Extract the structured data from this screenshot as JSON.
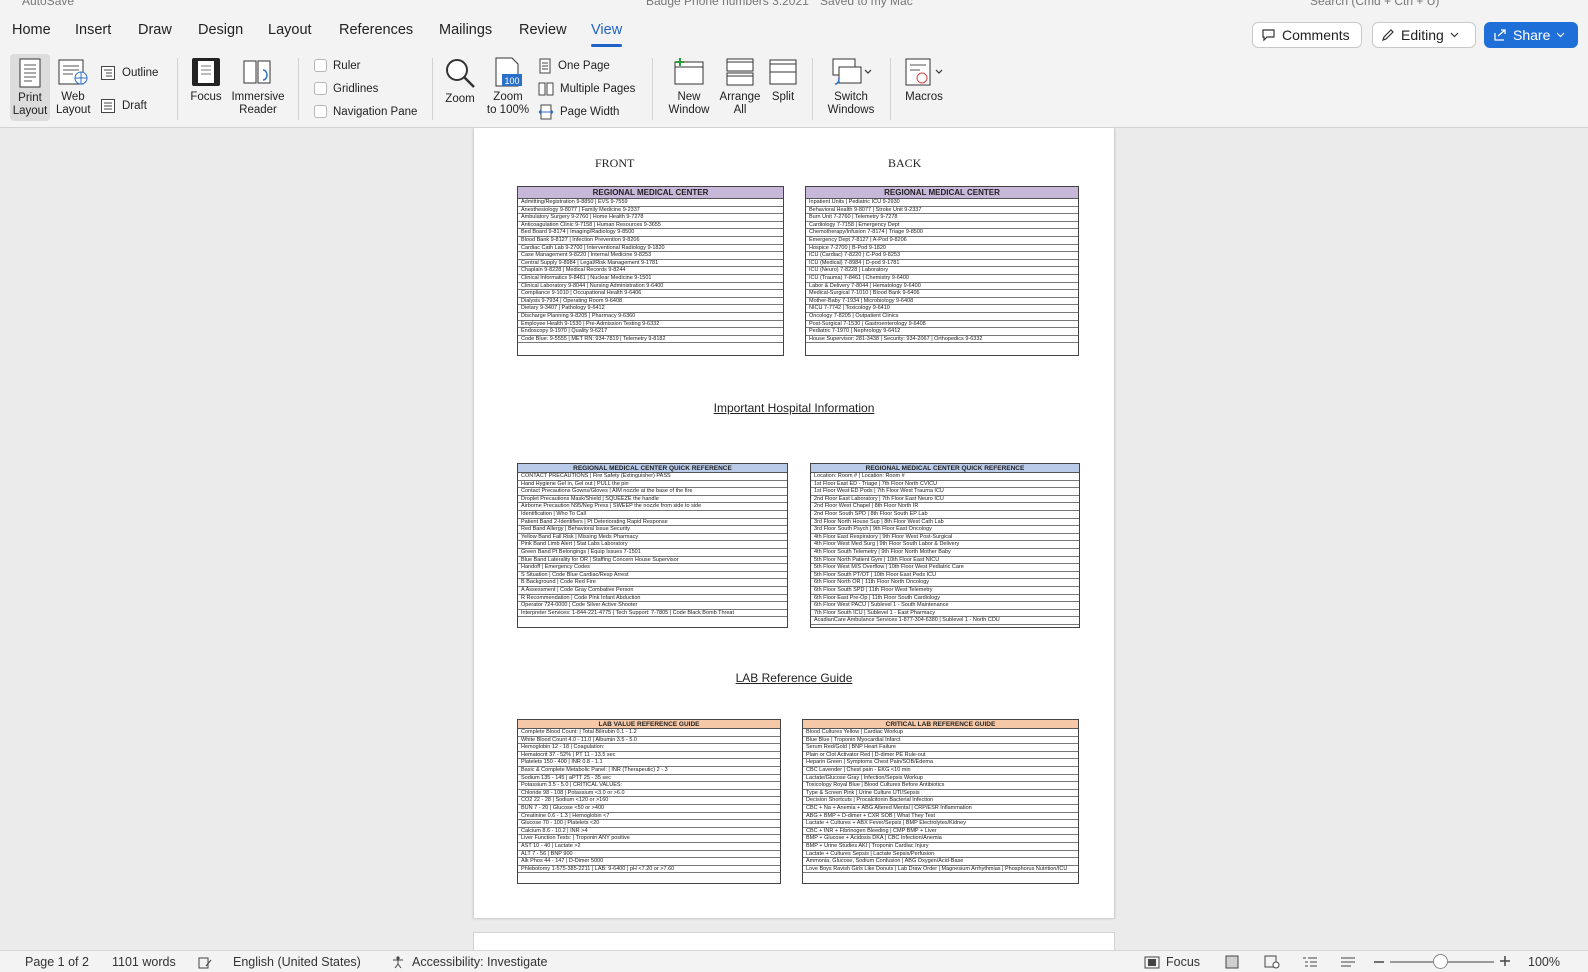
{
  "window": {
    "autosave_label": "AutoSave",
    "doc_title": "Badge Phone numbers 3.2021",
    "save_status": "Saved to my Mac",
    "search_placeholder": "Search (Cmd + Ctrl + U)"
  },
  "tabs": [
    "Home",
    "Insert",
    "Draw",
    "Design",
    "Layout",
    "References",
    "Mailings",
    "Review",
    "View"
  ],
  "active_tab": "View",
  "header_buttons": {
    "comments": "Comments",
    "editing": "Editing",
    "share": "Share"
  },
  "ribbon": {
    "print_layout": [
      "Print",
      "Layout"
    ],
    "web_layout": [
      "Web",
      "Layout"
    ],
    "outline": "Outline",
    "draft": "Draft",
    "focus": "Focus",
    "immersive_reader": [
      "Immersive",
      "Reader"
    ],
    "ruler": "Ruler",
    "gridlines": "Gridlines",
    "navigation_pane": "Navigation Pane",
    "zoom": "Zoom",
    "zoom_100": [
      "Zoom",
      "to 100%"
    ],
    "one_page": "One Page",
    "multiple_pages": "Multiple Pages",
    "page_width": "Page Width",
    "new_window": [
      "New",
      "Window"
    ],
    "arrange_all": [
      "Arrange",
      "All"
    ],
    "split": "Split",
    "switch_windows": [
      "Switch",
      "Windows"
    ],
    "macros": "Macros"
  },
  "document": {
    "front_label": "FRONT",
    "back_label": "BACK",
    "section1_title": "Important Hospital Information",
    "section2_title": "LAB Reference Guide",
    "cards": {
      "front": {
        "title": "REGIONAL MEDICAL CENTER",
        "rows": [
          "Admitting/Registration 9-8850 | EVS 9-7559",
          "Anesthesiology 9-8077 | Family Medicine 9-2337",
          "Ambulatory Surgery 9-2760 | Home Health 9-7278",
          "Anticoagulation Clinic 9-7158 | Human Resources 9-3655",
          "Bed Board 9-8174 | Imaging/Radiology 9-8500",
          "Blood Bank 9-8127 | Infection Prevention 9-8206",
          "Cardiac Cath Lab 9-2700 | Interventional Radiology 9-1820",
          "Case Management 9-8220 | Internal Medicine 9-8253",
          "Central Supply 9-8984 | Legal/Risk Management 9-1781",
          "Chaplain 9-8228 | Medical Records 9-8244",
          "Clinical Informatics 9-8461 | Nuclear Medicine 9-1501",
          "Clinical Laboratory 9-8044 | Nursing Administration 9-6400",
          "Compliance 9-1010 | Occupational Health 9-6406",
          "Dialysis 9-7934 | Operating Room 9-6408",
          "Dietary 9-3407 | Pathology 9-6412",
          "Discharge Planning 9-8205 | Pharmacy 9-6360",
          "Employee Health 9-1530 | Pre-Admission Testing 9-6332",
          "Endoscopy 9-1970 | Quality 9-6217",
          "Code Blue: 9-5555 | MET RN: 934-7819 | Telemetry 9-8182"
        ]
      },
      "back": {
        "title": "REGIONAL MEDICAL CENTER",
        "rows": [
          "Inpatient Units | Pediatric ICU 9-2930",
          "Behavioral Health 9-8077 | Stroke Unit 9-2337",
          "Burn Unit 7-2760 | Telemetry 9-7278",
          "Cardiology 7-7158 | Emergency Dept",
          "Chemotherapy/Infusion 7-8174 | Triage 9-8500",
          "Emergency Dept 7-8127 | A-Pod 9-8206",
          "Hospice 7-2700 | B-Pod 9-1820",
          "ICU (Cardiac) 7-8220 | C-Pod 9-8253",
          "ICU (Medical) 7-8984 | D-pod 9-1781",
          "ICU (Neuro) 7-8228 | Laboratory",
          "ICU (Trauma) 7-8461 | Chemistry 9-6400",
          "Labor & Delivery 7-8044 | Hematology 9-6400",
          "Medical-Surgical 7-1010 | Blood Bank 9-6406",
          "Mother-Baby 7-1934 | Microbiology 9-6408",
          "NICU 7-7742 | Toxicology 9-6410",
          "Oncology 7-8205 | Outpatient Clinics",
          "Post-Surgical 7-1530 | Gastroenterology 9-6408",
          "Pediatric 7-1970 | Nephrology 9-6412",
          "House Supervisor: 281-3438 | Security: 934-2067 | Orthopedics 9-6332"
        ]
      },
      "quick_ref": {
        "title": "REGIONAL MEDICAL CENTER QUICK REFERENCE",
        "rows": [
          "CONTACT PRECAUTIONS | Fire Safety (Extinguisher) PASS",
          "Hand Hygiene Gel in, Gel out | PULL the pin",
          "Contact Precautions Gowns/Gloves | AIM nozzle at the base of the fire",
          "Droplet Precautions Mask/Shield | SQUEEZE the handle",
          "Airborne Precaution N95/Neg Press | SWEEP the nozzle from side to side",
          "Identification | Who To Call",
          "Patient Band 2-Identifiers | Pt Deteriorating Rapid Response",
          "Red Band Allergy | Behavioral Issue Security",
          "Yellow Band Fall Risk | Missing Meds Pharmacy",
          "Pink Band Limb Alert | Stat Labs Laboratory",
          "Green Band Pt Belongings | Equip Issues 7-1501",
          "Blue Band Laterality for OR | Staffing Concern House Supervisor",
          "Handoff | Emergency Codes",
          "S Situation | Code Blue Cardiac/Resp Arrest",
          "B Background | Code Red Fire",
          "A Assessment | Code Gray Combative Person",
          "R Recommendation | Code Pink Infant Abduction",
          "Operator 724-0000 | Code Silver Active Shooter",
          "Interpreter Services: 1-844-221-4775 | Tech Support: 7-7805 | Code Black Bomb Threat"
        ]
      },
      "room_ref": {
        "title": "REGIONAL MEDICAL CENTER QUICK REFERENCE",
        "rows": [
          "Location: Room # | Location: Room #",
          "1st Floor East ED - Triage | 7th Floor North CVICU",
          "1st Floor West ED Pods | 7th Floor West Trauma ICU",
          "2nd Floor East Laboratory | 7th Floor East Neuro ICU",
          "2nd Floor West Chapel | 8th Floor North IR",
          "2nd Floor South SPD | 8th Floor South EP Lab",
          "3rd Floor North House Sup | 8th Floor West Cath Lab",
          "3rd Floor South Psych | 9th Floor East Oncology",
          "4th Floor East Respiratory | 9th Floor West Post-Surgical",
          "4th Floor West Med Surg | 9th Floor South Labor & Delivery",
          "4th Floor South Telemetry | 9th Floor North Mother Baby",
          "5th Floor North Patient Gym | 10th Floor East NICU",
          "5th Floor West M/S Overflow | 10th Floor West Pediatric Care",
          "5th Floor South PT/OT | 10th Floor East Peds ICU",
          "6th Floor North OR | 11th Floor North Oncology",
          "6th Floor South SPD | 11th Floor West Telemetry",
          "6th Floor East Pre-Op | 11th Floor South Cardiology",
          "6th Floor West PACU | Sublevel 1 - South Maintenance",
          "7th Floor South ICU | Sublevel 1 - East Pharmacy",
          "AcadianCare Ambulance Services 1-877-304-6380 | Sublevel 1 - North CDU"
        ]
      },
      "lab_value": {
        "title": "LAB VALUE REFERENCE GUIDE",
        "rows": [
          "Complete Blood Count: | Total Bilirubin 0.1 - 1.2",
          "White Blood Count 4.0 - 11.0 | Albumin 3.5 - 5.0",
          "Hemoglobin 12 - 18 | Coagulation:",
          "Hematocrit 37 - 52% | PT 11 - 13.5 sec",
          "Platelets 150 - 400 | INR 0.8 - 1.1",
          "Basic & Complete Metabolic Panel: | INR (Therapeutic) 2 - 3",
          "Sodium 135 - 145 | aPTT 25 - 35 sec",
          "Potassium 3.5 - 5.0 | CRITICAL VALUES:",
          "Chloride 98 - 108 | Potassium <3.0 or >6.0",
          "CO2 22 - 28 | Sodium <120 or >160",
          "BUN 7 - 20 | Glucose <50 or >400",
          "Creatinine 0.6 - 1.3 | Hemoglobin <7",
          "Glucose 70 - 100 | Platelets <20",
          "Calcium 8.6 - 10.2 | INR >4",
          "Liver Function Tests: | Troponin ANY positive",
          "AST 10 - 40 | Lactate >2",
          "ALT 7 - 56 | BNP 900",
          "Alk Phos 44 - 147 | D-Dimer 5000",
          "Phlebotomy 1-575-385-2211 | LAB: 9-6400 | pH <7.20 or >7.60"
        ]
      },
      "critical_lab": {
        "title": "CRITICAL LAB REFERENCE GUIDE",
        "rows": [
          "Blood Cultures Yellow | Cardiac Workup",
          "Blue Blue | Troponin Myocardial Infarct",
          "Serum Red/Gold | BNP Heart Failure",
          "Plain or Clot Activator Red | D-dimer PE Rule-out",
          "Heparin Green | Symptoms Chest Pain/SOB/Edema",
          "CBC Lavender | Chest pain - EKG <10 min",
          "Lactate/Glucose Gray | Infection/Sepsis Workup",
          "Toxicology Royal Blue | Blood Cultures Before Antibiotics",
          "Type & Screen Pink | Urine Culture UTI/Sepsis",
          "Decision Shortcuts | Procalcitonin Bacterial Infection",
          "CBC + Na + Anemia + ABG Altered Mental | CRP/ESR Inflammation",
          "ABG + BMP + D-dimer + CXR SOB | What They Test",
          "Lactate + Cultures + ABX Fever/Sepsis | BMP Electrolytes/Kidney",
          "CBC + INR + Fibrinogen Bleeding | CMP BMP + Liver",
          "BMP + Glucose + Acidosis DKA | CBC Infection/Anemia",
          "BMP + Urine Studies AKI | Troponin Cardiac Injury",
          "Lactate + Cultures Sepsis | Lactate Sepsis/Perfusion",
          "Ammonia, Glucose, Sodium Confusion | ABG Oxygen/Acid-Base",
          "Love Boys Ravish Girls Like Donuts | Lab Draw Order | Magnesium Arrhythmias | Phosphorus Nutrition/ICU"
        ]
      }
    }
  },
  "statusbar": {
    "page": "Page 1 of 2",
    "words": "1101 words",
    "language": "English (United States)",
    "accessibility": "Accessibility: Investigate",
    "focus": "Focus",
    "zoom": "100%"
  }
}
